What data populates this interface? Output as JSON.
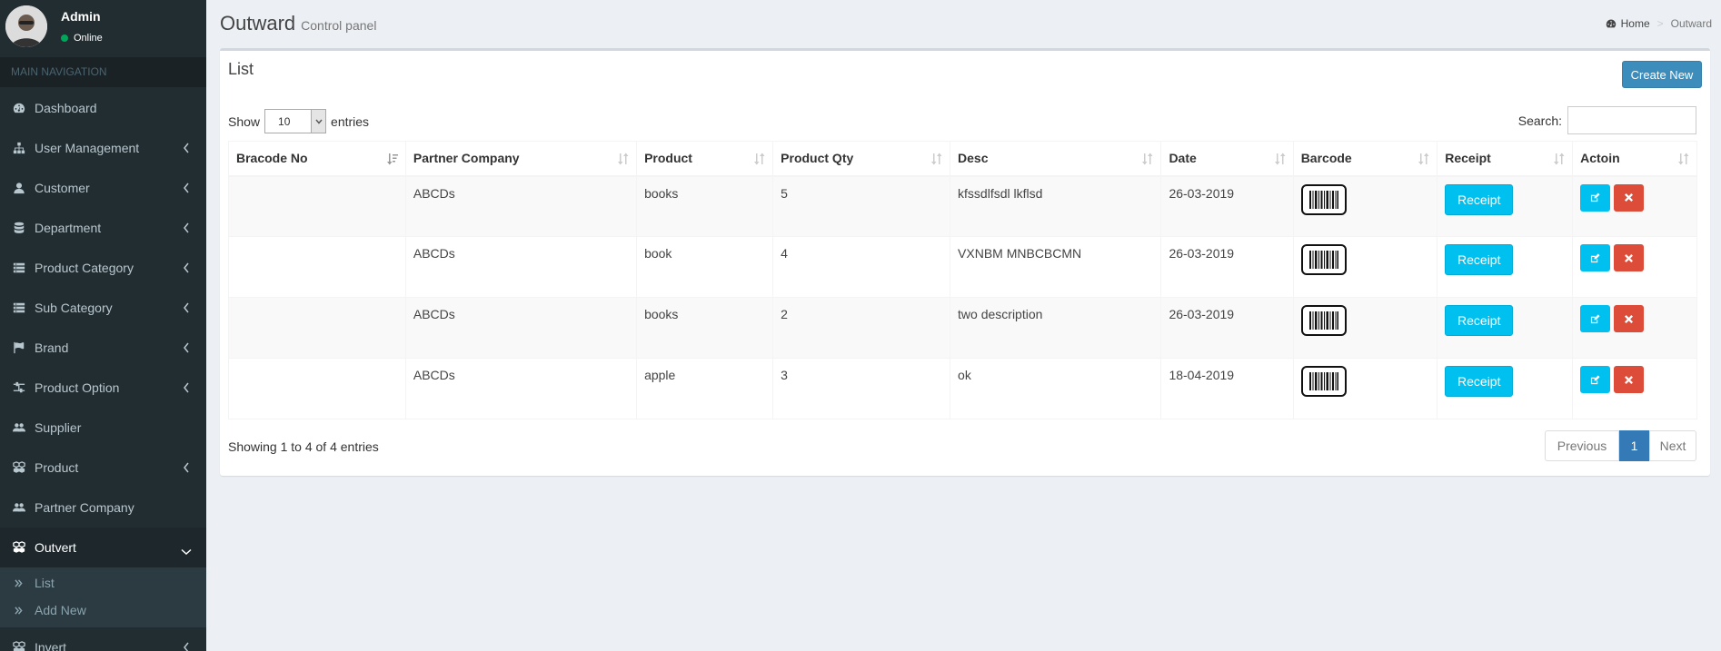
{
  "user": {
    "name": "Admin",
    "status": "Online"
  },
  "nav": {
    "header": "MAIN NAVIGATION",
    "items": [
      {
        "label": "Dashboard",
        "icon": "dashboard-icon",
        "chevron": false
      },
      {
        "label": "User Management",
        "icon": "sitemap-icon",
        "chevron": true
      },
      {
        "label": "Customer",
        "icon": "user-icon",
        "chevron": true
      },
      {
        "label": "Department",
        "icon": "database-icon",
        "chevron": true
      },
      {
        "label": "Product Category",
        "icon": "list-icon",
        "chevron": true
      },
      {
        "label": "Sub Category",
        "icon": "list-icon",
        "chevron": true
      },
      {
        "label": "Brand",
        "icon": "flag-icon",
        "chevron": true
      },
      {
        "label": "Product Option",
        "icon": "sliders-icon",
        "chevron": true
      },
      {
        "label": "Supplier",
        "icon": "users-icon",
        "chevron": false
      },
      {
        "label": "Product",
        "icon": "cubes-icon",
        "chevron": true
      },
      {
        "label": "Partner Company",
        "icon": "users-icon",
        "chevron": false
      },
      {
        "label": "Outvert",
        "icon": "cubes-icon",
        "chevron": true,
        "active": true
      },
      {
        "label": "Invert",
        "icon": "cubes-icon",
        "chevron": true
      }
    ],
    "submenu": [
      {
        "label": "List"
      },
      {
        "label": "Add New"
      }
    ]
  },
  "header": {
    "title": "Outward",
    "subtitle": "Control panel"
  },
  "breadcrumb": {
    "home": "Home",
    "current": "Outward"
  },
  "box": {
    "title": "List",
    "create_label": "Create New"
  },
  "entries": {
    "show_label": "Show",
    "value": "10",
    "entries_label": "entries"
  },
  "search": {
    "label": "Search:",
    "value": ""
  },
  "table": {
    "columns": [
      "Bracode No",
      "Partner Company",
      "Product",
      "Product Qty",
      "Desc",
      "Date",
      "Barcode",
      "Receipt",
      "Actoin"
    ],
    "rows": [
      {
        "bracode_no": "",
        "partner": "ABCDs",
        "product": "books",
        "qty": "5",
        "desc": "kfssdlfsdl lkflsd",
        "date": "26-03-2019"
      },
      {
        "bracode_no": "",
        "partner": "ABCDs",
        "product": "book",
        "qty": "4",
        "desc": "VXNBM MNBCBCMN",
        "date": "26-03-2019"
      },
      {
        "bracode_no": "",
        "partner": "ABCDs",
        "product": "books",
        "qty": "2",
        "desc": "two description",
        "date": "26-03-2019"
      },
      {
        "bracode_no": "",
        "partner": "ABCDs",
        "product": "apple",
        "qty": "3",
        "desc": "ok",
        "date": "18-04-2019"
      }
    ],
    "receipt_label": "Receipt"
  },
  "footer": {
    "info": "Showing 1 to 4 of 4 entries",
    "prev": "Previous",
    "page": "1",
    "next": "Next"
  },
  "colors": {
    "sidebar": "#222d32",
    "primary": "#3c8dbc",
    "info": "#00c0ef",
    "danger": "#dd4b39",
    "page_active": "#337ab7"
  }
}
